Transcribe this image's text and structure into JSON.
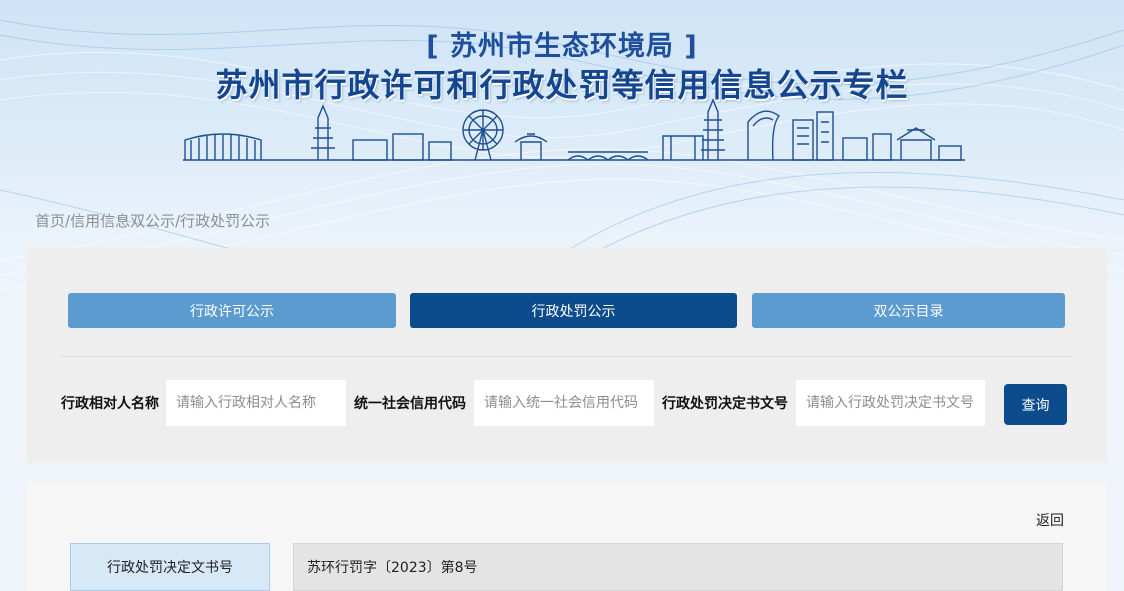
{
  "header": {
    "dept_title": "[ 苏州市生态环境局 ]",
    "main_title": "苏州市行政许可和行政处罚等信用信息公示专栏"
  },
  "breadcrumb": {
    "items": [
      "首页",
      "信用信息双公示",
      "行政处罚公示"
    ],
    "separator": " / "
  },
  "tabs": [
    {
      "label": "行政许可公示",
      "active": false
    },
    {
      "label": "行政处罚公示",
      "active": true
    },
    {
      "label": "双公示目录",
      "active": false
    }
  ],
  "search": {
    "fields": [
      {
        "label": "行政相对人名称",
        "placeholder": "请输入行政相对人名称",
        "value": ""
      },
      {
        "label": "统一社会信用代码",
        "placeholder": "请输入统一社会信用代码",
        "value": ""
      },
      {
        "label": "行政处罚决定书文号",
        "placeholder": "请输入行政处罚决定书文号",
        "value": ""
      }
    ],
    "button_label": "查询"
  },
  "detail": {
    "back_label": "返回",
    "rows": [
      {
        "label": "行政处罚决定文书号",
        "value": "苏环行罚字〔2023〕第8号"
      }
    ]
  },
  "colors": {
    "primary": "#0c4b8c",
    "tab_light": "#5b9bd0",
    "title": "#14468f"
  },
  "icons": [
    "city-skyline-illustration"
  ]
}
